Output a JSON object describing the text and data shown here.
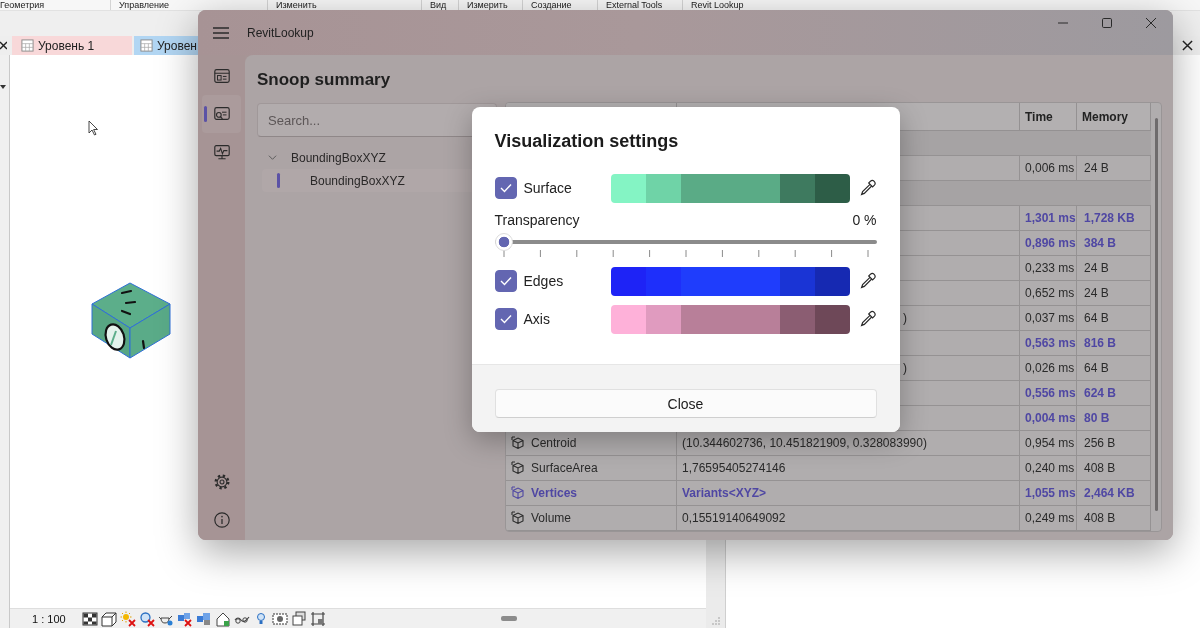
{
  "revit": {
    "ribbon_tabs": [
      "Геометрия",
      "Управление",
      "Изменить",
      "Вид",
      "Измерить",
      "Создание",
      "External Tools",
      "Revit Lookup"
    ],
    "view_tabs": [
      {
        "label": "Уровень 1",
        "selected": false
      },
      {
        "label": "Уровен",
        "selected": true
      }
    ],
    "scale": "1 : 100"
  },
  "window": {
    "title": "RevitLookup",
    "nav": [
      {
        "selected": false
      },
      {
        "selected": true
      },
      {
        "selected": false
      }
    ]
  },
  "page": {
    "title": "Snoop summary",
    "search": {
      "placeholder": "Search..."
    },
    "tree": [
      {
        "label": "BoundingBoxXYZ",
        "expanded": true,
        "selected": false,
        "children": [
          {
            "label": "BoundingBoxXYZ",
            "selected": true
          }
        ]
      }
    ],
    "table": {
      "header": {
        "column_3": "Time",
        "column_4": "Memory"
      },
      "rows": [
        {
          "kind": "group"
        },
        {
          "kind": "item",
          "highlighted": false,
          "time": "0,006 ms",
          "memory": "24 B"
        },
        {
          "kind": "group"
        },
        {
          "kind": "item",
          "highlighted": true,
          "time": "1,301 ms",
          "memory": "1,728 KB"
        },
        {
          "kind": "item",
          "highlighted": true,
          "time": "0,896 ms",
          "memory": "384 B"
        },
        {
          "kind": "item",
          "highlighted": false,
          "time": "0,233 ms",
          "memory": "24 B"
        },
        {
          "kind": "item",
          "highlighted": false,
          "time": "0,652 ms",
          "memory": "24 B"
        },
        {
          "kind": "item",
          "highlighted": false,
          "value_end": ")",
          "time": "0,037 ms",
          "memory": "64 B"
        },
        {
          "kind": "item",
          "highlighted": true,
          "time": "0,563 ms",
          "memory": "816 B"
        },
        {
          "kind": "item",
          "highlighted": false,
          "value_end": ")",
          "time": "0,026 ms",
          "memory": "64 B"
        },
        {
          "kind": "item",
          "highlighted": true,
          "time": "0,556 ms",
          "memory": "624 B"
        },
        {
          "kind": "item",
          "highlighted": true,
          "time": "0,004 ms",
          "memory": "80 B"
        },
        {
          "kind": "item",
          "highlighted": false,
          "name": "Centroid",
          "value": "(10.344602736, 10.451821909, 0.328083990)",
          "time": "0,954 ms",
          "memory": "256 B"
        },
        {
          "kind": "item",
          "highlighted": false,
          "name": "SurfaceArea",
          "value": "1,76595405274146",
          "time": "0,240 ms",
          "memory": "408 B"
        },
        {
          "kind": "item",
          "highlighted": true,
          "name": "Vertices",
          "value": "Variants<XYZ>",
          "time": "1,055 ms",
          "memory": "2,464 KB"
        },
        {
          "kind": "item",
          "highlighted": false,
          "name": "Volume",
          "value": "0,15519140649092",
          "time": "0,249 ms",
          "memory": "408 B"
        }
      ]
    }
  },
  "dialog": {
    "title": "Visualization settings",
    "rows": [
      {
        "kind": "color",
        "label": "Surface",
        "checked": true,
        "swatches": [
          {
            "color": "#84f4c4"
          },
          {
            "color": "#6fd3a7"
          },
          {
            "color": "#5aab86"
          },
          {
            "color": "#3e7a5f"
          },
          {
            "color": "#2d5d47"
          }
        ]
      },
      {
        "kind": "slider",
        "label": "Transparency",
        "reading": "0 %",
        "level": 0
      },
      {
        "kind": "color",
        "label": "Edges",
        "checked": true,
        "swatches": [
          {
            "color": "#1e23f6"
          },
          {
            "color": "#1e2ffb"
          },
          {
            "color": "#1f3dfc"
          },
          {
            "color": "#1a34d5"
          },
          {
            "color": "#1629b2"
          }
        ]
      },
      {
        "kind": "color",
        "label": "Axis",
        "checked": true,
        "swatches": [
          {
            "color": "#feb1d9"
          },
          {
            "color": "#e09bbf"
          },
          {
            "color": "#b87f99"
          },
          {
            "color": "#8b5d72"
          },
          {
            "color": "#6e4858"
          }
        ]
      }
    ],
    "close_button": "Close"
  }
}
